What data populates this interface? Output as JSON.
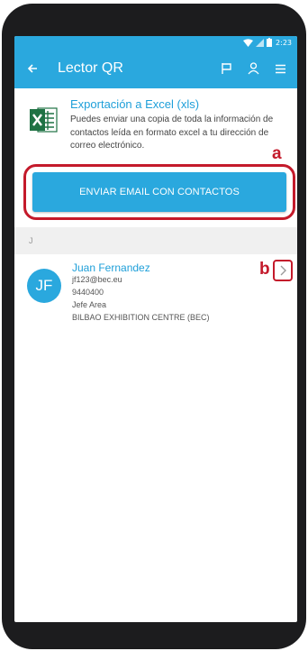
{
  "status_bar": {
    "time": "2:23",
    "icons": [
      "wifi-icon",
      "signal-icon",
      "battery-icon"
    ]
  },
  "app_bar": {
    "title": "Lector QR",
    "back_icon": "arrow-left-icon",
    "actions": [
      "flag-icon",
      "person-icon",
      "menu-icon"
    ]
  },
  "export": {
    "icon": "excel-icon",
    "title": "Exportación a Excel (xls)",
    "description": "Puedes enviar una copia de toda la información de contactos leída en formato excel a tu dirección de correo electrónico."
  },
  "send_button": {
    "label": "ENVIAR EMAIL CON CONTACTOS"
  },
  "annotations": {
    "a": "a",
    "b": "b"
  },
  "section": {
    "letter": "J"
  },
  "contacts": [
    {
      "initials": "JF",
      "name": "Juan Fernandez",
      "email": "jf123@bec.eu",
      "phone": "9440400",
      "role": "Jefe Area",
      "company": "BILBAO EXHIBITION CENTRE (BEC)",
      "chevron_icon": "chevron-right-icon"
    }
  ],
  "colors": {
    "primary": "#2aa8de",
    "highlight": "#c41a2b",
    "link": "#1e9fd9",
    "section_bg": "#f0f0f0"
  }
}
